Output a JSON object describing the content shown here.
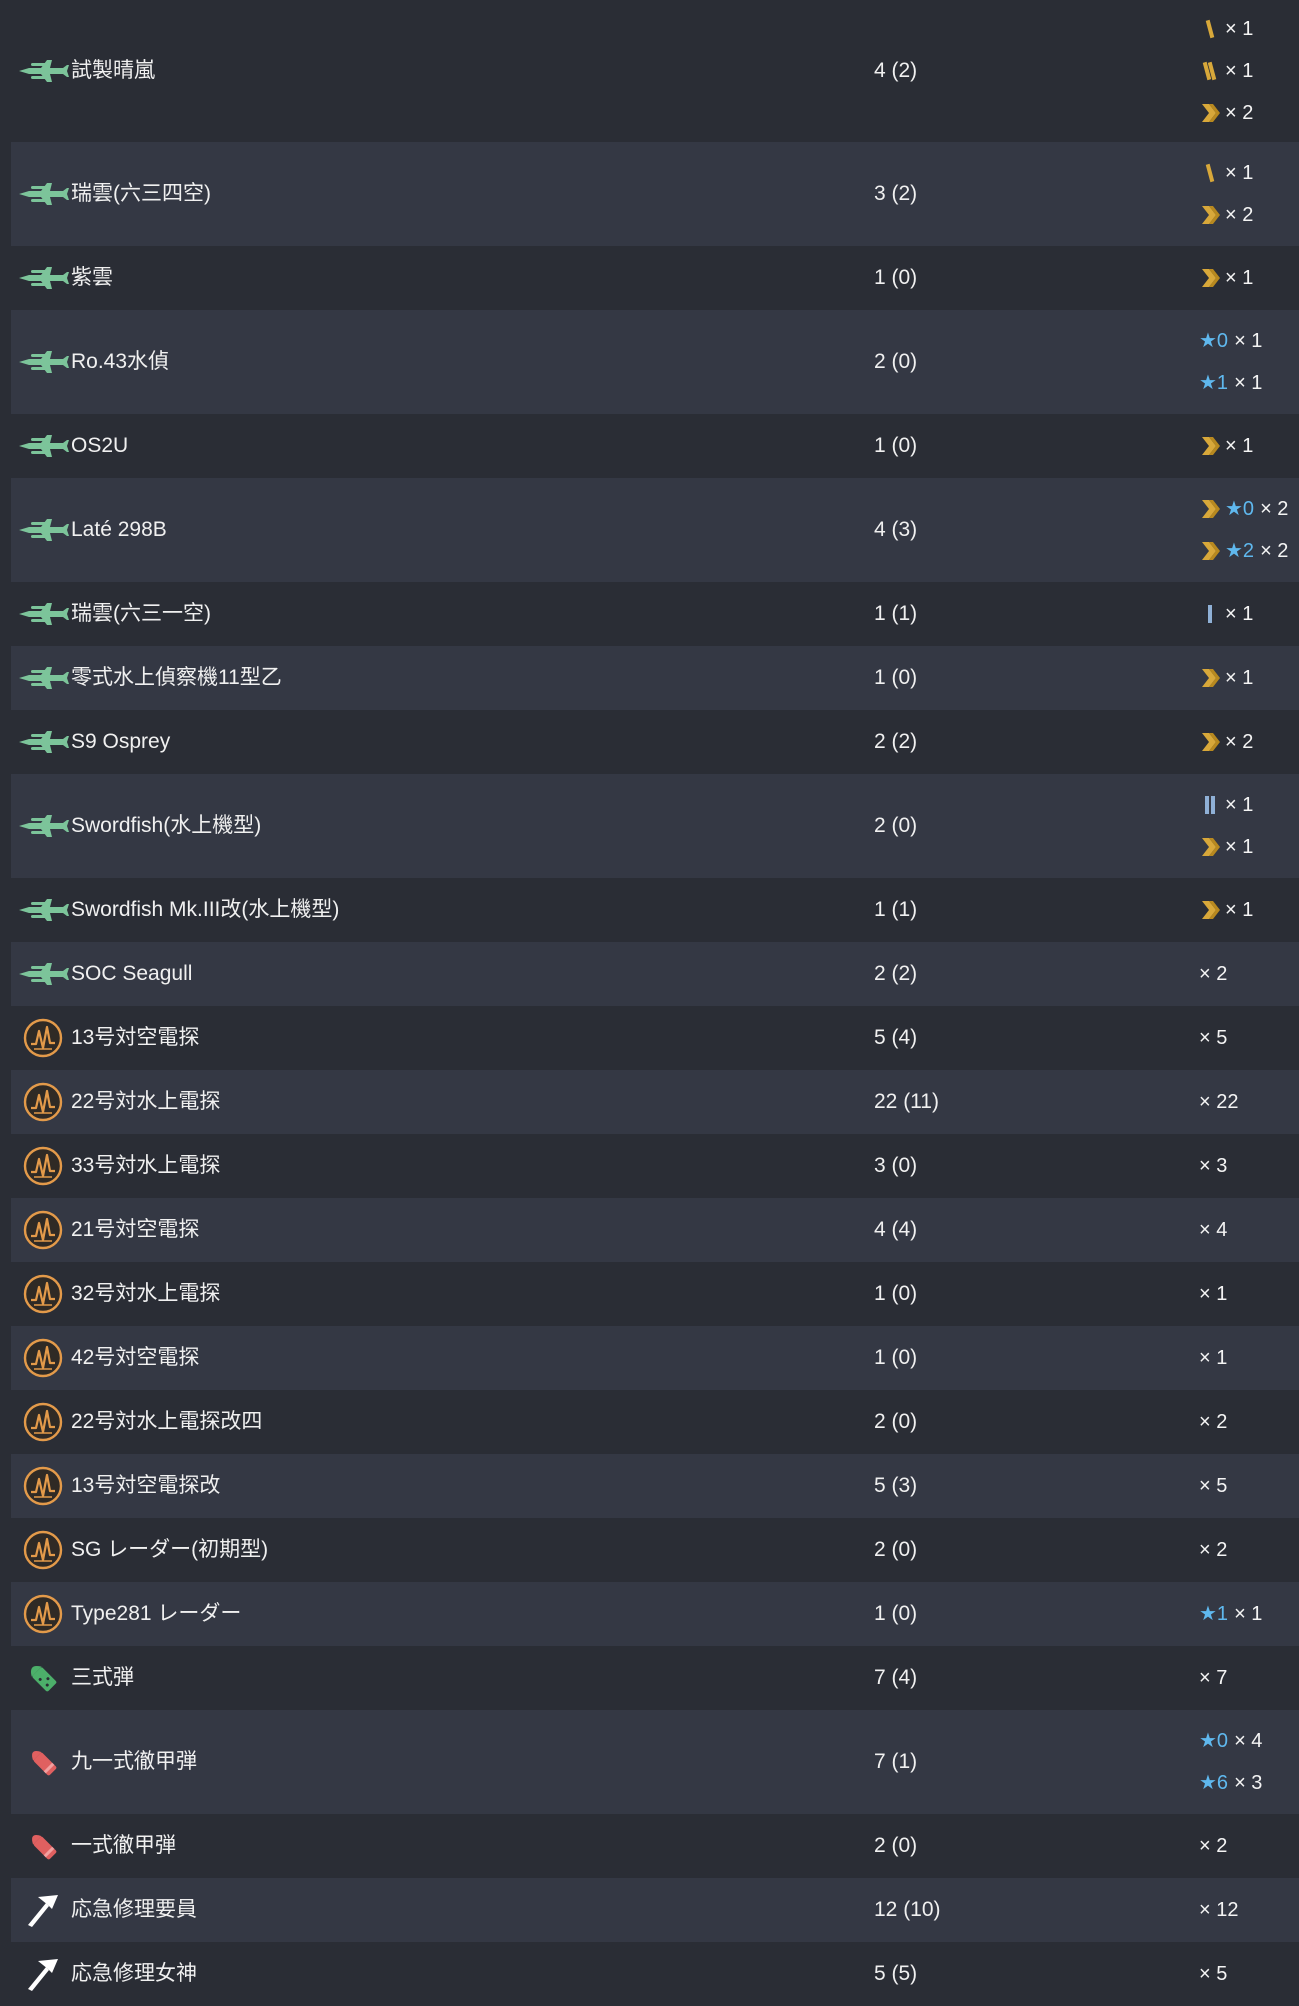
{
  "colors": {
    "row_odd": "#2a2d35",
    "row_even": "#343844",
    "plane_green": "#7cc49a",
    "radar_orange": "#e39a4a",
    "proficiency_gold": "#d8a83a",
    "proficiency_blue": "#8fb0d6",
    "star_blue": "#5fb8ee",
    "shell_green": "#4caf6a",
    "shell_red": "#e06060"
  },
  "rows": [
    {
      "name": "試製晴嵐",
      "count": "4 (2)",
      "icon": "seaplane-icon",
      "breakdown": [
        {
          "prof": "1",
          "star": "",
          "mult": "× 1"
        },
        {
          "prof": "2",
          "star": "",
          "mult": "× 1"
        },
        {
          "prof": "max",
          "star": "",
          "mult": "× 2"
        }
      ]
    },
    {
      "name": "瑞雲(六三四空)",
      "count": "3 (2)",
      "icon": "seaplane-icon",
      "breakdown": [
        {
          "prof": "1",
          "star": "",
          "mult": "× 1"
        },
        {
          "prof": "max",
          "star": "",
          "mult": "× 2"
        }
      ]
    },
    {
      "name": "紫雲",
      "count": "1 (0)",
      "icon": "seaplane-icon",
      "breakdown": [
        {
          "prof": "max",
          "star": "",
          "mult": "× 1"
        }
      ]
    },
    {
      "name": "Ro.43水偵",
      "count": "2 (0)",
      "icon": "seaplane-icon",
      "breakdown": [
        {
          "prof": "",
          "star": "★0",
          "mult": "× 1"
        },
        {
          "prof": "",
          "star": "★1",
          "mult": "× 1"
        }
      ]
    },
    {
      "name": "OS2U",
      "count": "1 (0)",
      "icon": "seaplane-icon",
      "breakdown": [
        {
          "prof": "max",
          "star": "",
          "mult": "× 1"
        }
      ]
    },
    {
      "name": "Laté 298B",
      "count": "4 (3)",
      "icon": "seaplane-icon",
      "breakdown": [
        {
          "prof": "max",
          "star": "★0",
          "mult": "× 2"
        },
        {
          "prof": "max",
          "star": "★2",
          "mult": "× 2"
        }
      ]
    },
    {
      "name": "瑞雲(六三一空)",
      "count": "1 (1)",
      "icon": "seaplane-icon",
      "breakdown": [
        {
          "prof": "b1",
          "star": "",
          "mult": "× 1"
        }
      ]
    },
    {
      "name": "零式水上偵察機11型乙",
      "count": "1 (0)",
      "icon": "seaplane-icon",
      "breakdown": [
        {
          "prof": "max",
          "star": "",
          "mult": "× 1"
        }
      ]
    },
    {
      "name": "S9 Osprey",
      "count": "2 (2)",
      "icon": "seaplane-icon",
      "breakdown": [
        {
          "prof": "max",
          "star": "",
          "mult": "× 2"
        }
      ]
    },
    {
      "name": "Swordfish(水上機型)",
      "count": "2 (0)",
      "icon": "seaplane-icon",
      "breakdown": [
        {
          "prof": "b2",
          "star": "",
          "mult": "× 1"
        },
        {
          "prof": "max",
          "star": "",
          "mult": "× 1"
        }
      ]
    },
    {
      "name": "Swordfish Mk.III改(水上機型)",
      "count": "1 (1)",
      "icon": "seaplane-icon",
      "breakdown": [
        {
          "prof": "max",
          "star": "",
          "mult": "× 1"
        }
      ]
    },
    {
      "name": "SOC Seagull",
      "count": "2 (2)",
      "icon": "seaplane-icon",
      "breakdown": [
        {
          "prof": "",
          "star": "",
          "mult": "× 2"
        }
      ]
    },
    {
      "name": "13号対空電探",
      "count": "5 (4)",
      "icon": "radar-icon",
      "breakdown": [
        {
          "prof": "",
          "star": "",
          "mult": "× 5"
        }
      ]
    },
    {
      "name": "22号対水上電探",
      "count": "22 (11)",
      "icon": "radar-icon",
      "breakdown": [
        {
          "prof": "",
          "star": "",
          "mult": "× 22"
        }
      ]
    },
    {
      "name": "33号対水上電探",
      "count": "3 (0)",
      "icon": "radar-icon",
      "breakdown": [
        {
          "prof": "",
          "star": "",
          "mult": "× 3"
        }
      ]
    },
    {
      "name": "21号対空電探",
      "count": "4 (4)",
      "icon": "radar-icon",
      "breakdown": [
        {
          "prof": "",
          "star": "",
          "mult": "× 4"
        }
      ]
    },
    {
      "name": "32号対水上電探",
      "count": "1 (0)",
      "icon": "radar-icon",
      "breakdown": [
        {
          "prof": "",
          "star": "",
          "mult": "× 1"
        }
      ]
    },
    {
      "name": "42号対空電探",
      "count": "1 (0)",
      "icon": "radar-icon",
      "breakdown": [
        {
          "prof": "",
          "star": "",
          "mult": "× 1"
        }
      ]
    },
    {
      "name": "22号対水上電探改四",
      "count": "2 (0)",
      "icon": "radar-icon",
      "breakdown": [
        {
          "prof": "",
          "star": "",
          "mult": "× 2"
        }
      ]
    },
    {
      "name": "13号対空電探改",
      "count": "5 (3)",
      "icon": "radar-icon",
      "breakdown": [
        {
          "prof": "",
          "star": "",
          "mult": "× 5"
        }
      ]
    },
    {
      "name": "SG レーダー(初期型)",
      "count": "2 (0)",
      "icon": "radar-icon",
      "breakdown": [
        {
          "prof": "",
          "star": "",
          "mult": "× 2"
        }
      ]
    },
    {
      "name": "Type281 レーダー",
      "count": "1 (0)",
      "icon": "radar-icon",
      "breakdown": [
        {
          "prof": "",
          "star": "★1",
          "mult": "× 1"
        }
      ]
    },
    {
      "name": "三式弾",
      "count": "7 (4)",
      "icon": "type3-shell-icon",
      "breakdown": [
        {
          "prof": "",
          "star": "",
          "mult": "× 7"
        }
      ]
    },
    {
      "name": "九一式徹甲弾",
      "count": "7 (1)",
      "icon": "ap-shell-icon",
      "breakdown": [
        {
          "prof": "",
          "star": "★0",
          "mult": "× 4"
        },
        {
          "prof": "",
          "star": "★6",
          "mult": "× 3"
        }
      ]
    },
    {
      "name": "一式徹甲弾",
      "count": "2 (0)",
      "icon": "ap-shell-icon",
      "breakdown": [
        {
          "prof": "",
          "star": "",
          "mult": "× 2"
        }
      ]
    },
    {
      "name": "応急修理要員",
      "count": "12 (10)",
      "icon": "repair-icon",
      "breakdown": [
        {
          "prof": "",
          "star": "",
          "mult": "× 12"
        }
      ]
    },
    {
      "name": "応急修理女神",
      "count": "5 (5)",
      "icon": "repair-icon",
      "breakdown": [
        {
          "prof": "",
          "star": "",
          "mult": "× 5"
        }
      ]
    }
  ]
}
